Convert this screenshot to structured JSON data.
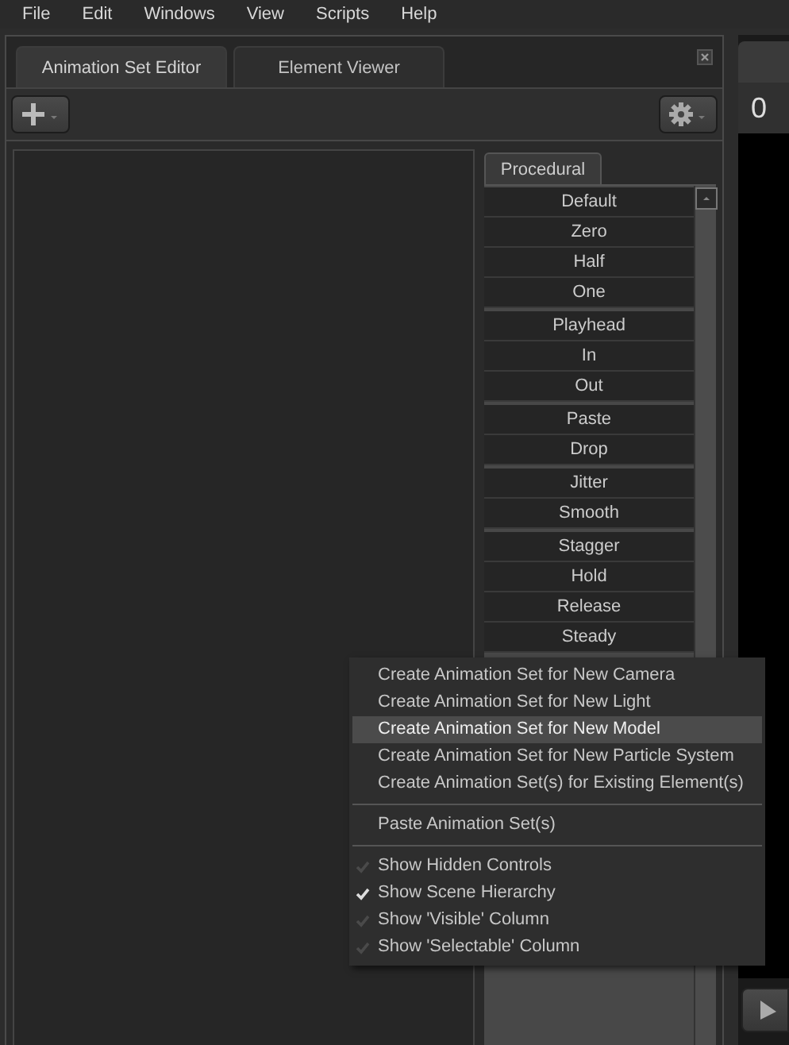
{
  "menu_bar": [
    "File",
    "Edit",
    "Windows",
    "View",
    "Scripts",
    "Help"
  ],
  "tabs": [
    {
      "label": "Animation Set Editor",
      "selected": true
    },
    {
      "label": "Element Viewer",
      "selected": false
    }
  ],
  "procedural": {
    "tab": "Procedural",
    "groups": [
      [
        "Default",
        "Zero",
        "Half",
        "One"
      ],
      [
        "Playhead",
        "In",
        "Out"
      ],
      [
        "Paste",
        "Drop"
      ],
      [
        "Jitter",
        "Smooth"
      ],
      [
        "Stagger",
        "Hold",
        "Release",
        "Steady"
      ]
    ]
  },
  "context_menu": [
    {
      "kind": "action",
      "label": "Create Animation Set for New Camera",
      "selected": false
    },
    {
      "kind": "action",
      "label": "Create Animation Set for New Light",
      "selected": false
    },
    {
      "kind": "action",
      "label": "Create Animation Set for New Model",
      "selected": true
    },
    {
      "kind": "action",
      "label": "Create Animation Set for New Particle System",
      "selected": false
    },
    {
      "kind": "action",
      "label": "Create Animation Set(s) for Existing Element(s)",
      "selected": false
    },
    {
      "kind": "separator"
    },
    {
      "kind": "action",
      "label": "Paste Animation Set(s)",
      "selected": false
    },
    {
      "kind": "separator"
    },
    {
      "kind": "check",
      "label": "Show Hidden Controls",
      "checked": false
    },
    {
      "kind": "check",
      "label": "Show Scene Hierarchy",
      "checked": true
    },
    {
      "kind": "check",
      "label": "Show 'Visible' Column",
      "checked": false
    },
    {
      "kind": "check",
      "label": "Show 'Selectable' Column",
      "checked": false
    }
  ],
  "right_panel": {
    "value": "0"
  }
}
